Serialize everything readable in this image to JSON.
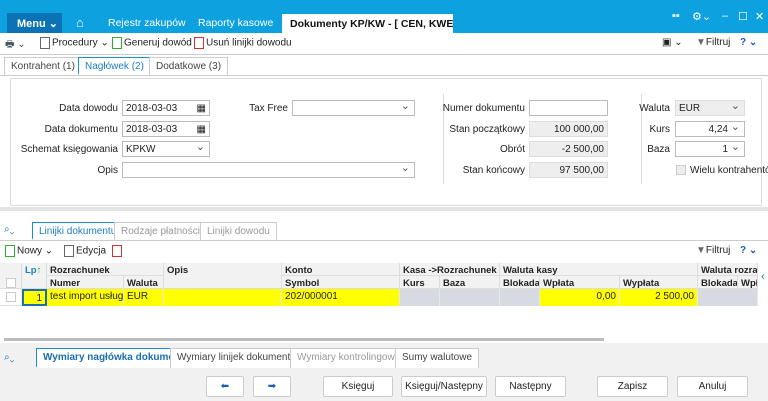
{
  "titlebar": {
    "menu": "Menu",
    "tabs": [
      "Rejestr zakupów",
      "Raporty kasowe"
    ],
    "active_tab": "Dokumenty KP/KW - [ CEN, KWEUR"
  },
  "toolbar": {
    "procedury": "Procedury",
    "generuj": "Generuj dowód",
    "usun": "Usuń linijki dowodu",
    "filtruj": "Filtruj"
  },
  "top_tabs": [
    "Kontrahent (1)",
    "Nagłówek (2)",
    "Dodatkowe (3)"
  ],
  "form": {
    "data_dowodu_label": "Data dowodu",
    "data_dowodu": "2018-03-03",
    "data_dokumentu_label": "Data dokumentu",
    "data_dokumentu": "2018-03-03",
    "schemat_label": "Schemat księgowania",
    "schemat": "KPKW",
    "opis_label": "Opis",
    "opis": "",
    "tax_free_label": "Tax Free",
    "tax_free": "",
    "numer_label": "Numer dokumentu",
    "numer": "",
    "stan_pocz_label": "Stan początkowy",
    "stan_pocz": "100 000,00",
    "obrot_label": "Obrót",
    "obrot": "-2 500,00",
    "stan_konc_label": "Stan końcowy",
    "stan_konc": "97 500,00",
    "waluta_label": "Waluta",
    "waluta": "EUR",
    "kurs_label": "Kurs",
    "kurs": "4,24",
    "baza_label": "Baza",
    "baza": "1",
    "wielu_label": "Wielu kontrahentów"
  },
  "mid_tabs": [
    "Linijki dokumentu",
    "Rodzaje płatności",
    "Linijki dowodu"
  ],
  "grid_toolbar": {
    "nowy": "Nowy",
    "edycja": "Edycja",
    "filtruj": "Filtruj"
  },
  "grid": {
    "group_headers": {
      "lp": "Lp",
      "rozrachunek": "Rozrachunek",
      "opis": "Opis",
      "konto": "Konto",
      "kasa": "Kasa ->Rozrachunek",
      "waluta_kasy": "Waluta kasy",
      "waluta_rozr": "Waluta rozrac"
    },
    "sub_headers": {
      "numer": "Numer",
      "waluta": "Waluta",
      "symbol": "Symbol",
      "kurs": "Kurs",
      "baza": "Baza",
      "blokada": "Blokada",
      "wplata": "Wpłata",
      "wyplata": "Wypłata",
      "blokada2": "Blokada",
      "wpl2": "Wpł"
    },
    "rows": [
      {
        "lp": "1",
        "numer": "test import usług",
        "waluta": "EUR",
        "opis": "",
        "symbol": "202/000001",
        "kurs": "",
        "baza": "",
        "blokada": "",
        "wplata": "0,00",
        "wyplata": "2 500,00"
      }
    ],
    "highlight": "#ffff00"
  },
  "bottom_tabs": [
    "Wymiary nagłówka dokumentu",
    "Wymiary linijek dokumentu",
    "Wymiary kontrolingowe",
    "Sumy walutowe"
  ],
  "buttons": {
    "ksieguj": "Księguj",
    "ksieguj_nast": "Księguj/Następny",
    "nastepny": "Następny",
    "zapisz": "Zapisz",
    "anuluj": "Anuluj"
  }
}
